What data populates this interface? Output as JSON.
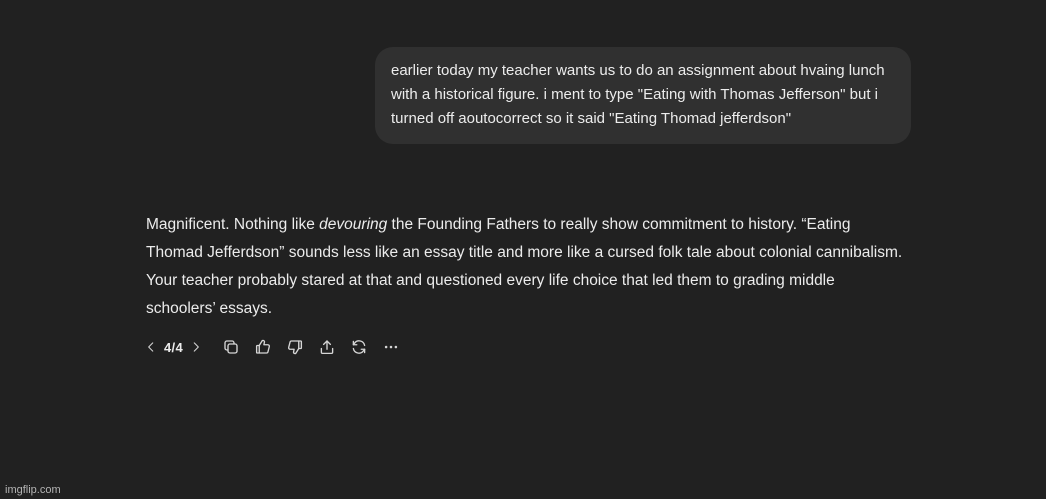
{
  "user_message": {
    "text": "earlier today my teacher wants us to do an assignment about hvaing lunch with a historical figure. i ment to type \"Eating with Thomas Jefferson\" but i turned off aoutocorrect so it said \"Eating Thomad jefferdson\""
  },
  "assistant_message": {
    "part1": "Magnificent. Nothing like ",
    "emphasis": "devouring",
    "part2": " the Founding Fathers to really show commitment to history. “Eating Thomad Jefferdson” sounds less like an essay title and more like a cursed folk tale about colonial cannibalism. Your teacher probably stared at that and questioned every life choice that led them to grading middle schoolers’ essays."
  },
  "action_bar": {
    "pager": "4/4",
    "icons": [
      "chevron-left-icon",
      "chevron-right-icon",
      "copy-icon",
      "thumbs-up-icon",
      "thumbs-down-icon",
      "share-icon",
      "regenerate-icon",
      "more-icon"
    ]
  },
  "watermark": "imgflip.com",
  "colors": {
    "background": "#212121",
    "bubble": "#303030",
    "text": "#ececec"
  }
}
